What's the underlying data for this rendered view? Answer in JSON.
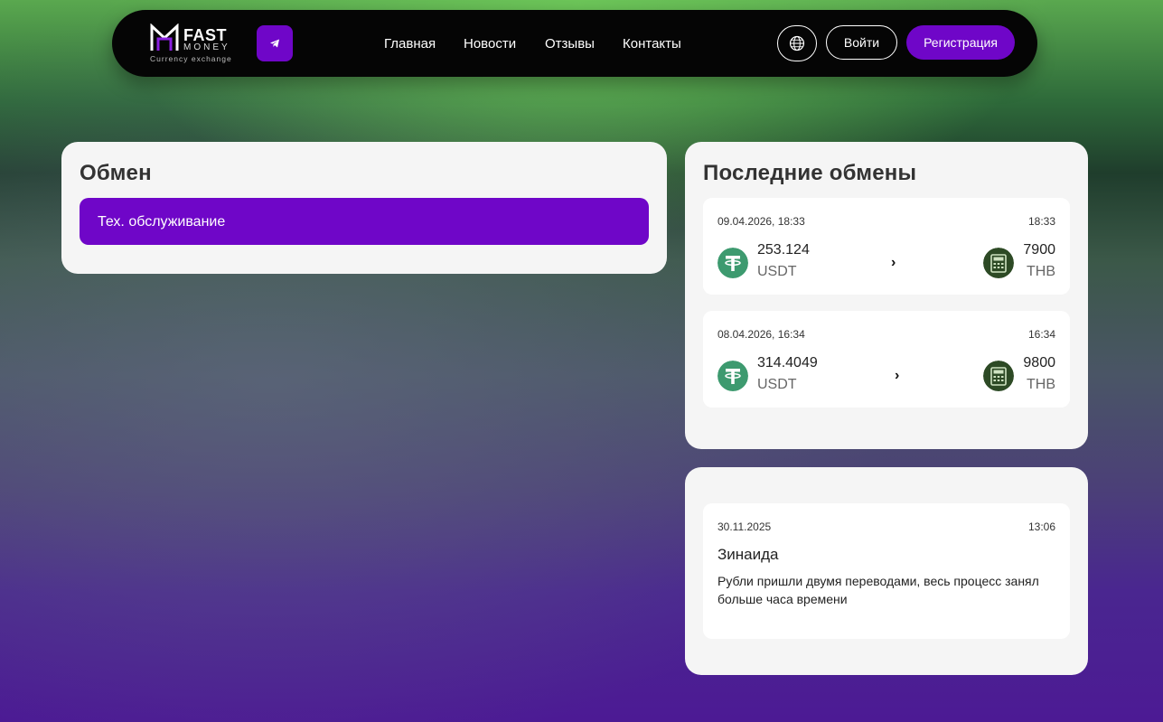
{
  "header": {
    "logo": {
      "line1": "FAST",
      "line2": "MONEY",
      "tagline": "Currency exchange"
    },
    "nav": [
      {
        "label": "Главная"
      },
      {
        "label": "Новости"
      },
      {
        "label": "Отзывы"
      },
      {
        "label": "Контакты"
      }
    ],
    "login_label": "Войти",
    "register_label": "Регистрация",
    "icons": {
      "telegram": "telegram-icon",
      "language": "globe-icon"
    }
  },
  "exchange": {
    "title": "Обмен",
    "status": "Тех. обслуживание"
  },
  "recent": {
    "title": "Последние обмены",
    "items": [
      {
        "date": "09.04.2026, 18:33",
        "time": "18:33",
        "from_amount": "253.124",
        "from_currency": "USDT",
        "to_amount": "7900",
        "to_currency": "THB",
        "arrow": "›"
      },
      {
        "date": "08.04.2026, 16:34",
        "time": "16:34",
        "from_amount": "314.4049",
        "from_currency": "USDT",
        "to_amount": "9800",
        "to_currency": "THB",
        "arrow": "›"
      }
    ]
  },
  "reviews": {
    "items": [
      {
        "date": "30.11.2025",
        "time": "13:06",
        "author": "Зинаида",
        "text": "Рубли пришли двумя переводами, весь процесс занял больше часа времени"
      }
    ]
  },
  "colors": {
    "accent": "#6f06c8",
    "navbar": "#050505",
    "card": "#f5f5f5",
    "tether": "#3d9a6f",
    "atm": "#2d4a25"
  }
}
